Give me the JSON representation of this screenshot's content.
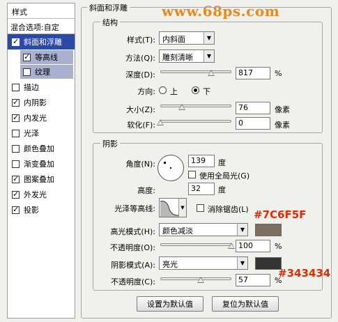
{
  "watermark": "www.68ps.com",
  "sidebar": {
    "title": "样式",
    "blend_options": "混合选项:自定",
    "items": [
      {
        "label": "斜面和浮雕",
        "checked": true,
        "selected": true
      },
      {
        "label": "等高线",
        "checked": true,
        "sub": true
      },
      {
        "label": "纹理",
        "checked": false,
        "sub": true
      },
      {
        "label": "描边",
        "checked": false
      },
      {
        "label": "内阴影",
        "checked": true
      },
      {
        "label": "内发光",
        "checked": true
      },
      {
        "label": "光泽",
        "checked": false
      },
      {
        "label": "颜色叠加",
        "checked": false
      },
      {
        "label": "渐变叠加",
        "checked": false
      },
      {
        "label": "图案叠加",
        "checked": true
      },
      {
        "label": "外发光",
        "checked": true
      },
      {
        "label": "投影",
        "checked": true
      }
    ]
  },
  "main": {
    "title": "斜面和浮雕",
    "structure": {
      "title": "结构",
      "style_label": "样式(T):",
      "style_value": "内斜面",
      "technique_label": "方法(Q):",
      "technique_value": "雕刻清晰",
      "depth_label": "深度(D):",
      "depth_value": "817",
      "depth_unit": "%",
      "depth_fraction": 0.72,
      "direction_label": "方向:",
      "direction_up": "上",
      "direction_down": "下",
      "size_label": "大小(Z):",
      "size_value": "76",
      "size_unit": "像素",
      "size_fraction": 0.3,
      "soften_label": "软化(F):",
      "soften_value": "0",
      "soften_unit": "像素",
      "soften_fraction": 0.0
    },
    "shading": {
      "title": "阴影",
      "angle_label": "角度(N):",
      "angle_value": "139",
      "angle_unit": "度",
      "global_light_label": "使用全局光(G)",
      "altitude_label": "高度:",
      "altitude_value": "32",
      "altitude_unit": "度",
      "gloss_label": "光泽等高线:",
      "antialias_label": "消除锯齿(L)",
      "highlight_mode_label": "高光模式(H):",
      "highlight_mode_value": "颜色减淡",
      "highlight_color": "#7C6F5F",
      "highlight_opacity_label": "不透明度(O):",
      "highlight_opacity_value": "100",
      "highlight_opacity_fraction": 1.0,
      "opacity_unit": "%",
      "shadow_mode_label": "阴影模式(A):",
      "shadow_mode_value": "亮光",
      "shadow_color": "#343434",
      "shadow_opacity_label": "不透明度(C):",
      "shadow_opacity_value": "57",
      "shadow_opacity_fraction": 0.57
    },
    "buttons": {
      "make_default": "设置为默认值",
      "reset_default": "复位为默认值"
    }
  },
  "annotations": {
    "highlight_hex": "#7C6F5F",
    "shadow_hex": "#343434"
  }
}
